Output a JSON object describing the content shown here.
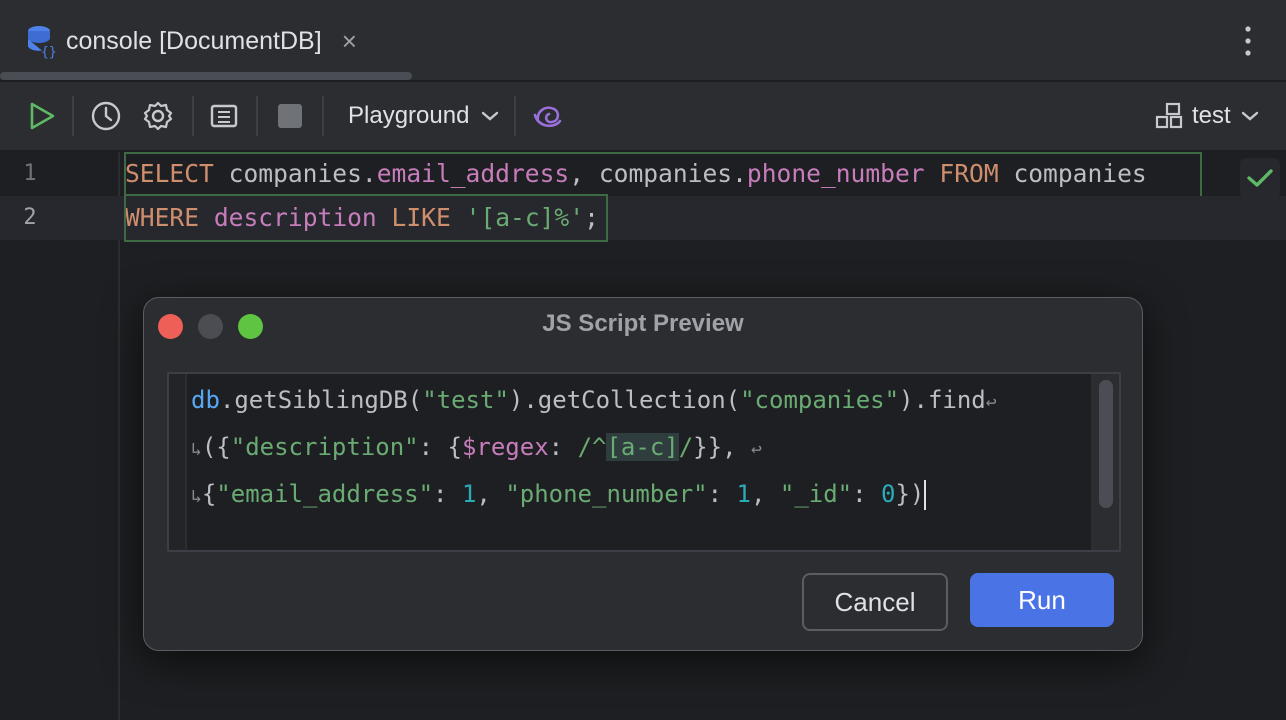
{
  "tab": {
    "title": "console [DocumentDB]",
    "close_glyph": "×"
  },
  "toolbar": {
    "mode_label": "Playground",
    "schema_label": "test"
  },
  "editor": {
    "lines": [
      {
        "number": "1",
        "parts": [
          {
            "t": "SELECT",
            "c": "kw"
          },
          {
            "t": " companies.",
            "c": ""
          },
          {
            "t": "email_address",
            "c": "col"
          },
          {
            "t": ", companies.",
            "c": ""
          },
          {
            "t": "phone_number",
            "c": "col"
          },
          {
            "t": " ",
            "c": ""
          },
          {
            "t": "FROM",
            "c": "kw"
          },
          {
            "t": " companies",
            "c": ""
          }
        ]
      },
      {
        "number": "2",
        "parts": [
          {
            "t": "WHERE",
            "c": "kw"
          },
          {
            "t": " ",
            "c": ""
          },
          {
            "t": "description",
            "c": "col"
          },
          {
            "t": " ",
            "c": ""
          },
          {
            "t": "LIKE",
            "c": "kw"
          },
          {
            "t": " ",
            "c": ""
          },
          {
            "t": "'[a-c]%'",
            "c": "str"
          },
          {
            "t": ";",
            "c": ""
          }
        ]
      }
    ]
  },
  "dialog": {
    "title": "JS Script Preview",
    "script_lines": [
      [
        {
          "t": "db",
          "c": "js-db"
        },
        {
          "t": ".getSiblingDB(",
          "c": ""
        },
        {
          "t": "\"test\"",
          "c": "js-str"
        },
        {
          "t": ").getCollection(",
          "c": ""
        },
        {
          "t": "\"companies\"",
          "c": "js-str"
        },
        {
          "t": ").find",
          "c": ""
        },
        {
          "t": "↩",
          "c": "wrap-mark"
        }
      ],
      [
        {
          "t": "↳",
          "c": "wrap-mark"
        },
        {
          "t": "({",
          "c": ""
        },
        {
          "t": "\"description\"",
          "c": "js-str"
        },
        {
          "t": ": {",
          "c": ""
        },
        {
          "t": "$regex",
          "c": "js-key"
        },
        {
          "t": ": ",
          "c": ""
        },
        {
          "t": "/^",
          "c": "js-str"
        },
        {
          "t": "[a-c]",
          "c": "js-str js-hl"
        },
        {
          "t": "/",
          "c": "js-str"
        },
        {
          "t": "}}, ",
          "c": ""
        },
        {
          "t": "↩",
          "c": "wrap-mark"
        }
      ],
      [
        {
          "t": "↳",
          "c": "wrap-mark"
        },
        {
          "t": "{",
          "c": ""
        },
        {
          "t": "\"email_address\"",
          "c": "js-str"
        },
        {
          "t": ": ",
          "c": ""
        },
        {
          "t": "1",
          "c": "js-num"
        },
        {
          "t": ", ",
          "c": ""
        },
        {
          "t": "\"phone_number\"",
          "c": "js-str"
        },
        {
          "t": ": ",
          "c": ""
        },
        {
          "t": "1",
          "c": "js-num"
        },
        {
          "t": ", ",
          "c": ""
        },
        {
          "t": "\"_id\"",
          "c": "js-str"
        },
        {
          "t": ": ",
          "c": ""
        },
        {
          "t": "0",
          "c": "js-num"
        },
        {
          "t": "})",
          "c": ""
        }
      ]
    ],
    "cancel_label": "Cancel",
    "run_label": "Run"
  },
  "colors": {
    "accent": "#4a73e6",
    "run_icon": "#5fb865",
    "ai_icon": "#9b6fdc"
  },
  "icons": [
    "database-console-icon",
    "close-icon",
    "more-vertical-icon",
    "run-icon",
    "history-icon",
    "settings-icon",
    "layout-icon",
    "stop-icon",
    "chevron-down-icon",
    "ai-assistant-icon",
    "schema-icon",
    "check-icon"
  ]
}
